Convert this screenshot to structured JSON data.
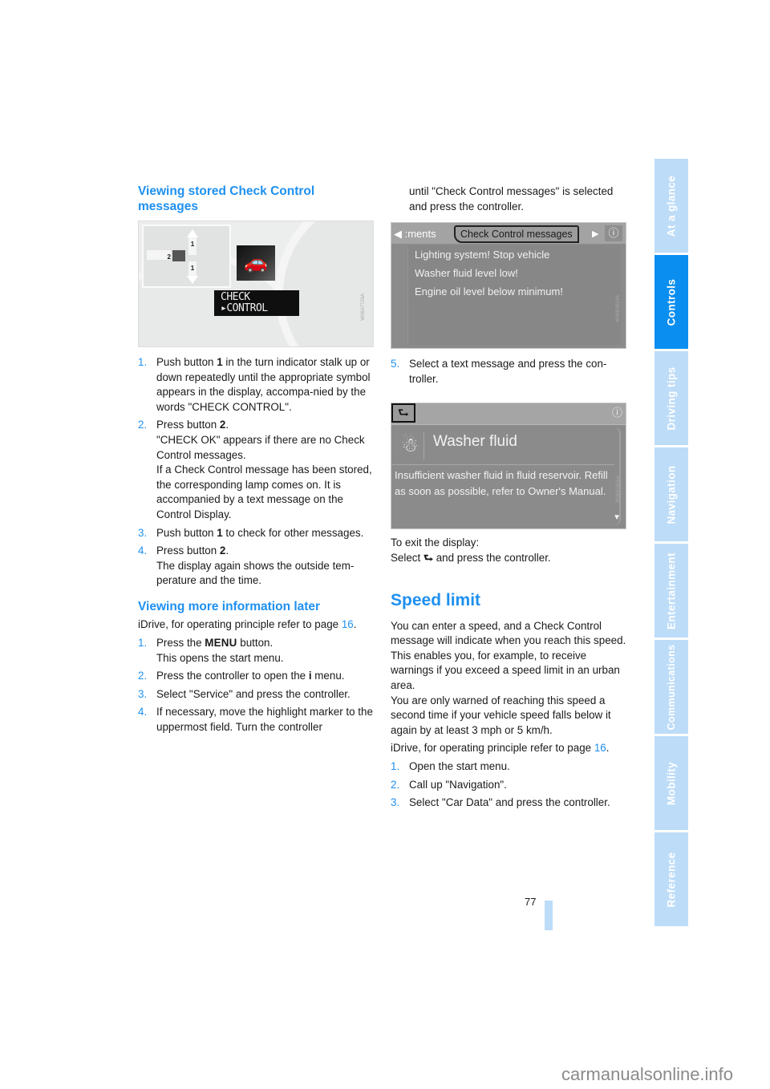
{
  "left": {
    "heading": "Viewing stored Check Control messages",
    "figure1": {
      "lcd_line1": "CHECK",
      "lcd_line2": "▸CONTROL",
      "car_icon": "car-icon",
      "stalk_labels": [
        "1",
        "2",
        "1"
      ],
      "image_code": "W06A7726A"
    },
    "steps": [
      {
        "num": "1.",
        "parts": [
          {
            "t": "Push button "
          },
          {
            "t": "1",
            "b": true
          },
          {
            "t": " in the turn indicator stalk up or down repeatedly until the appropriate symbol appears in the display, accompa-nied by the words \"CHECK CONTROL\"."
          }
        ]
      },
      {
        "num": "2.",
        "parts": [
          {
            "t": "Press button "
          },
          {
            "t": "2",
            "b": true
          },
          {
            "t": "."
          }
        ],
        "extra": [
          "\"CHECK OK\" appears if there are no Check Control messages.",
          "If a Check Control message has been stored, the corresponding lamp comes on. It is accompanied by a text message on the Control Display."
        ]
      },
      {
        "num": "3.",
        "parts": [
          {
            "t": "Push button "
          },
          {
            "t": "1",
            "b": true
          },
          {
            "t": " to check for other messages."
          }
        ]
      },
      {
        "num": "4.",
        "parts": [
          {
            "t": "Press button "
          },
          {
            "t": "2",
            "b": true
          },
          {
            "t": "."
          }
        ],
        "extra": [
          "The display again shows the outside tem-perature and the time."
        ]
      }
    ],
    "subheading2": "Viewing more information later",
    "idrive_prefix": "iDrive, for operating principle refer to page ",
    "idrive_page": "16",
    "idrive_suffix": ".",
    "steps2": [
      {
        "num": "1.",
        "pre": "Press the ",
        "key": "MENU",
        "post": " button.",
        "extra": "This opens the start menu."
      },
      {
        "num": "2.",
        "pre": "Press the controller to open the ",
        "key": "i",
        "post": " menu."
      },
      {
        "num": "3.",
        "pre": "Select \"Service\" and press the controller."
      },
      {
        "num": "4.",
        "pre": "If necessary, move the highlight marker to the uppermost field. Turn the controller"
      }
    ]
  },
  "right": {
    "continuation": "until \"Check Control messages\" is selected and press the controller.",
    "figure2": {
      "prev_tab": "◀ :ments",
      "active_tab": "Check Control messages",
      "next_arrow": "▶",
      "info_icon": "ⓘ",
      "messages": [
        "Lighting system! Stop vehicle",
        "Washer fluid level low!",
        "Engine oil level below minimum!"
      ],
      "image_code": "W06B1624A"
    },
    "step5": {
      "num": "5.",
      "text": "Select a text message and press the con-troller."
    },
    "figure3": {
      "back_icon": "⮑",
      "title": "Washer fluid",
      "body": "Insufficient washer fluid in fluid reservoir. Refill as soon as possible, refer to Owner's Manual.",
      "image_code": "W06B1626A"
    },
    "exit_line1": "To exit the display:",
    "exit_pre": "Select ",
    "exit_post": " and press the controller.",
    "section_title": "Speed limit",
    "para1": "You can enter a speed, and a Check Control message will indicate when you reach this speed. This enables you, for example, to receive warnings if you exceed a speed limit in an urban area.",
    "para2": "You are only warned of reaching this speed a second time if your vehicle speed falls below it again by at least 3 mph or 5 km/h.",
    "idrive_prefix": "iDrive, for operating principle refer to page ",
    "idrive_page": "16",
    "idrive_suffix": ".",
    "steps": [
      {
        "num": "1.",
        "text": "Open the start menu."
      },
      {
        "num": "2.",
        "text": "Call up \"Navigation\"."
      },
      {
        "num": "3.",
        "text": "Select \"Car Data\" and press the controller."
      }
    ]
  },
  "sidetabs": [
    {
      "label": "At a glance",
      "active": false
    },
    {
      "label": "Controls",
      "active": true
    },
    {
      "label": "Driving tips",
      "active": false
    },
    {
      "label": "Navigation",
      "active": false
    },
    {
      "label": "Entertainment",
      "active": false
    },
    {
      "label": "Communications",
      "active": false
    },
    {
      "label": "Mobility",
      "active": false
    },
    {
      "label": "Reference",
      "active": false
    }
  ],
  "page_number": "77",
  "watermark": "carmanualsonline.info",
  "colors": {
    "accent": "#1e90f0",
    "tab_active": "#0a8ef0",
    "tab_inactive": "#bddcf8"
  }
}
